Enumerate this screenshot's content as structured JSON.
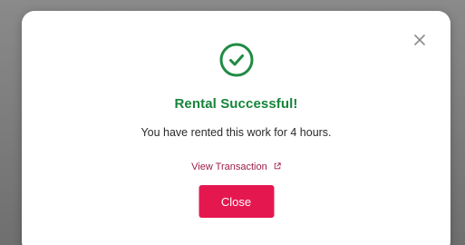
{
  "modal": {
    "title": "Rental Successful!",
    "message": "You have rented this work for 4 hours.",
    "link_label": "View Transaction",
    "close_button_label": "Close",
    "icons": {
      "success": "check-circle-icon",
      "dismiss": "close-icon",
      "external_link": "external-link-icon"
    }
  },
  "colors": {
    "success_green": "#1f8a43",
    "title_green": "#16843a",
    "link": "#9d1c4a",
    "primary_button": "#e5174f",
    "backdrop": "#7c7c7c"
  }
}
